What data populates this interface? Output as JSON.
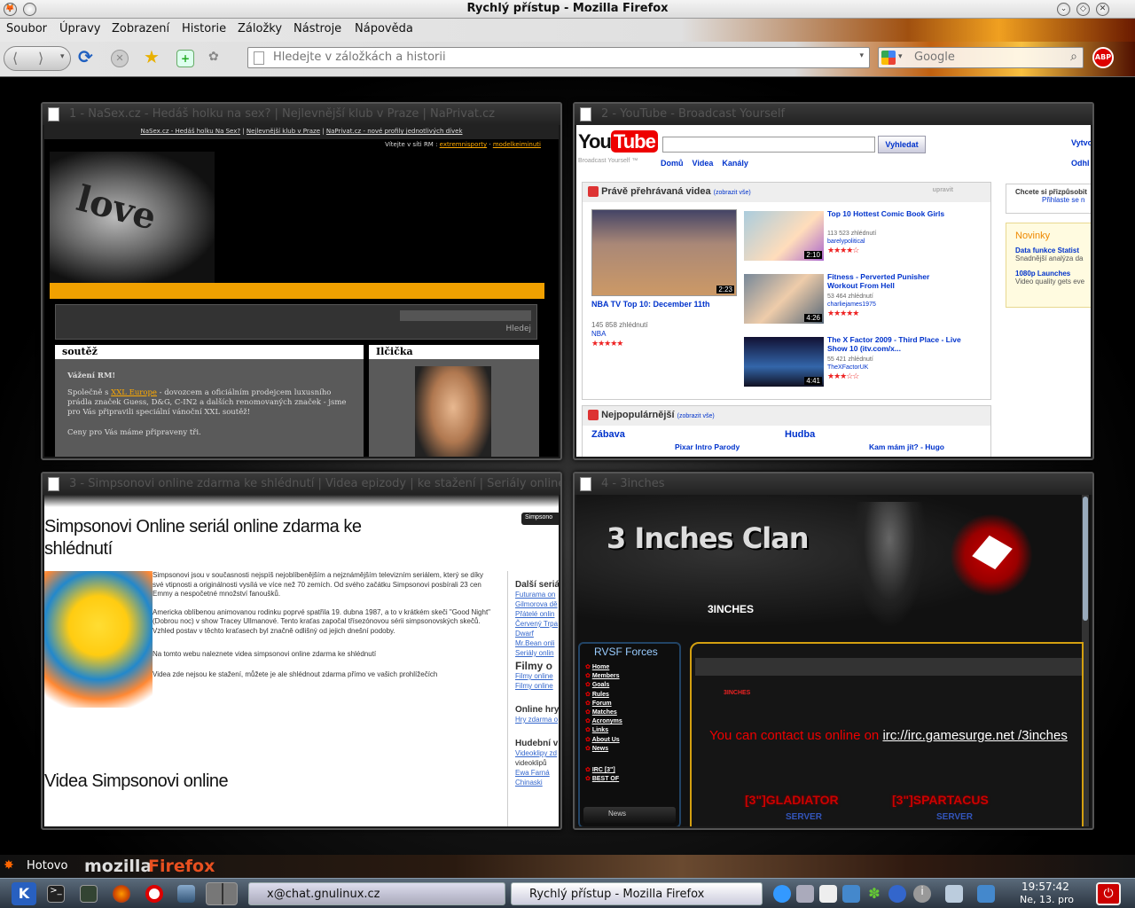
{
  "window": {
    "title": "Rychlý přístup - Mozilla Firefox"
  },
  "menu": [
    "Soubor",
    "Úpravy",
    "Zobrazení",
    "Historie",
    "Záložky",
    "Nástroje",
    "Nápověda"
  ],
  "urlbar": {
    "placeholder": "Hledejte v záložkách a historii"
  },
  "searchbar": {
    "placeholder": "Google"
  },
  "thumbs": [
    {
      "title": "1 - NaSex.cz - Hedáš holku na sex? | Nejlevnější klub v Praze | NaPrivat.cz"
    },
    {
      "title": "2 - YouTube - Broadcast Yourself"
    },
    {
      "title": "3 - Simpsonovi online zdarma ke shlédnutí | Videa epizody | ke stažení | Seriály online"
    },
    {
      "title": "4 - 3inches"
    }
  ],
  "p1": {
    "toplinks": [
      "NaSex.cz - Hedáš holku Na Sex?",
      "Nejlevnější klub v Praze",
      "NaPrivat.cz - nové profily jednotlivých dívek"
    ],
    "welcome": "Vítejte v síti RM :",
    "welcome_links": [
      "extremnisporty",
      "modelkeiminuti"
    ],
    "search_btn": "Hledej",
    "box1_title": "soutěž",
    "box2_title": "Ilčička",
    "greeting": "Vážení RM!",
    "text_a": "Společně s",
    "text_link": "XXL Europe",
    "text_b": "- dovozcem a oficiálním prodejcem luxusního prádla značek Guess, D&G, C-IN2 a dalších renomovaných značek - jsme pro Vás připravili speciální vánoční XXL soutěž!",
    "text2": "Ceny pro Vás máme připraveny tři."
  },
  "p2": {
    "logo_you": "You",
    "logo_tube": "Tube",
    "tagline": "Broadcast Yourself ™",
    "search_btn": "Vyhledat",
    "nav": [
      "Domů",
      "Videa",
      "Kanály"
    ],
    "right_links": [
      "Vytvo",
      "Odhl"
    ],
    "section1": "Právě přehrávaná videa",
    "show_all": "(zobrazit vše)",
    "edit": "upravit",
    "big_video": {
      "title": "NBA TV Top 10: December 11th",
      "views": "145 858 zhlédnutí",
      "user": "NBA",
      "duration": "2:23",
      "stars": "★★★★★"
    },
    "videos": [
      {
        "title": "Top 10 Hottest Comic Book Girls",
        "views": "113 523 zhlédnutí",
        "user": "barelypolitical",
        "duration": "2:10",
        "stars": "★★★★☆"
      },
      {
        "title": "Fitness - Perverted Punisher Workout From Hell",
        "views": "53 464 zhlédnutí",
        "user": "charliejames1975",
        "duration": "4:26",
        "stars": "★★★★★"
      },
      {
        "title": "The X Factor 2009 - Third Place - Live Show 10 (itv.com/x...",
        "views": "55 421 zhlédnutí",
        "user": "TheXFactorUK",
        "duration": "4:41",
        "stars": "★★★☆☆"
      }
    ],
    "section2": "Nejpopulárnější",
    "cat1": "Zábava",
    "cat2": "Hudba",
    "pop1": "Pixar Intro Parody",
    "pop2": "Kam mám jít? - Hugo",
    "side_box1": "Chcete si přizpůsobit",
    "side_box1_link": "Přihlaste se n",
    "news_title": "Novinky",
    "news": [
      {
        "title": "Data funkce Statist",
        "text": "Snadnější analýza da"
      },
      {
        "title": "1080p Launches",
        "text": "Video quality gets eve"
      }
    ]
  },
  "p3": {
    "heading": "Simpsonovi Online seriál online zdarma ke shlédnutí",
    "btn": "Simpsono",
    "para1": "Simpsonovi jsou v současnosti nejspíš nejoblíbenějším a nejznámějším televizním seriálem, který se díky své vtipnosti a originálnosti vysílá ve více než 70 zemích. Od svého začátku Simpsonovi posbírali 23 cen Emmy a nespočetné množství fanoušků.",
    "para2": "Americka oblíbenou animovanou rodinku poprvé spatřila 19. dubna 1987, a to v krátkém skeči \"Good Night\" (Dobrou noc) v show Tracey Ullmanové. Tento kraťas započal třísezónovou sérii simpsonovských skečů. Vzhled postav v těchto kraťasech byl značně odlišný od jejich dnešní podoby.",
    "para3": "Na tomto webu naleznete videa simpsonovi online zdarma ke shlédnutí",
    "para4": "Videa zde nejsou ke stažení, můžete je ale shlédnout zdarma přímo ve vašich prohlížečích",
    "heading2": "Videa Simpsonovi online",
    "side_h1": "Další seriá",
    "side_links1": [
      "Futurama on",
      "Gilmorova dě",
      "Přátelé onlin",
      "Červený Trpa Dwarf",
      "Mr.Bean onli",
      "Seriály onlin"
    ],
    "side_h2": "Filmy o",
    "side_links2": [
      "Filmy online",
      "Filmy online"
    ],
    "side_h3": "Online hry",
    "side_links3": [
      "Hry zdarma o"
    ],
    "side_h4": "Hudební v",
    "side_links4": [
      "Videoklipy zd",
      "videoklipů",
      "Ewa Farná",
      "Chinaski"
    ]
  },
  "p4": {
    "logo": "3 Inches Clan",
    "logo_sub": "3INCHES",
    "menu_title": "RVSF Forces",
    "menu": [
      "Home",
      "Members",
      "Goals",
      "Rules",
      "Forum",
      "Matches",
      "Acronyms",
      "Links",
      "About Us",
      "News"
    ],
    "irc": [
      "IRC [3\"]",
      "BEST OF"
    ],
    "news_tab": "News",
    "post_author": "3INCHES",
    "contact_text": "You can contact us online on",
    "contact_link": "irc://irc.gamesurge.net /3inches",
    "server1": "[3\"]GLADIATOR",
    "server2": "[3\"]SPARTACUS",
    "server_label": "SERVER"
  },
  "status": {
    "text": "Hotovo",
    "brand1": "mozilla",
    "brand2": "Firefox"
  },
  "taskbar": {
    "tasks": [
      "x@chat.gnulinux.cz",
      "Rychlý přístup - Mozilla Firefox"
    ],
    "time": "19:57:42",
    "date": "Ne, 13. pro"
  },
  "colors": {
    "accent_orange": "#f0a000",
    "yt_red": "#e00",
    "p4_red": "#e00"
  }
}
